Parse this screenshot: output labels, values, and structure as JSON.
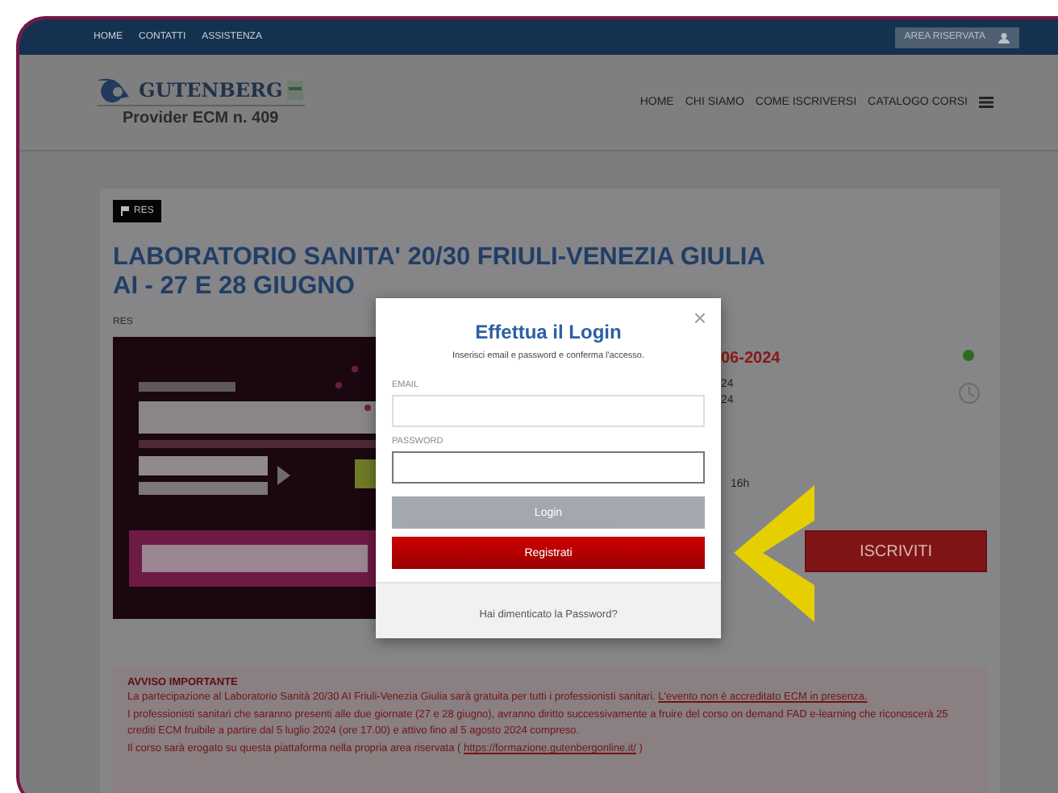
{
  "top_bar": {
    "links": [
      "HOME",
      "CONTATTI",
      "ASSISTENZA"
    ],
    "account_button": "AREA RISERVATA"
  },
  "header": {
    "logo": {
      "name": "GUTENBERG",
      "provider": "Provider ECM n. 409"
    },
    "nav": [
      "HOME",
      "CHI SIAMO",
      "COME ISCRIVERSI",
      "CATALOGO CORSI"
    ]
  },
  "course": {
    "badge": "RES",
    "title": "LABORATORIO SANITA' 20/30 FRIULI-VENEZIA GIULIA AI - 27 E 28 GIUGNO",
    "type": "RES",
    "details": {
      "date": "06-2024",
      "active": true,
      "lines": [
        "24",
        "24"
      ],
      "hours": "16h",
      "cta": "ISCRIVITI"
    },
    "notice": {
      "title": "AVVISO IMPORTANTE",
      "intro": "La partecipazione al Laboratorio Sanità 20/30 AI Friuli-Venezia Giulia sarà gratuita per tutti i professionisti sanitari.",
      "intro_link": "L'evento non è accreditato ECM in presenza.",
      "body": "I professionisti sanitari che saranno presenti alle due giornate (27 e 28 giugno), avranno diritto successivamente a fruire del corso on demand FAD e-learning che riconoscerà 25 crediti ECM fruibile a partire dal 5 luglio 2024 (ore 17.00) e attivo fino al 5 agosto 2024 compreso.",
      "platform": "Il corso sarà erogato su questa piattaforma nella propria area riservata (",
      "platform_link": "https://formazione.gutenbergonline.it/",
      "platform_end": ")"
    }
  },
  "login_dialog": {
    "close": "×",
    "title": "Effettua il Login",
    "subtitle": "Inserisci email e password e conferma l'accesso.",
    "fields": [
      {
        "label": "EMAIL",
        "focused": false
      },
      {
        "label": "PASSWORD",
        "focused": true
      }
    ],
    "buttons": [
      {
        "label": "Login",
        "kind": "disabled"
      },
      {
        "label": "Registrati",
        "kind": "primary"
      }
    ],
    "forgot_link": "Hai dimenticato la Password?"
  }
}
